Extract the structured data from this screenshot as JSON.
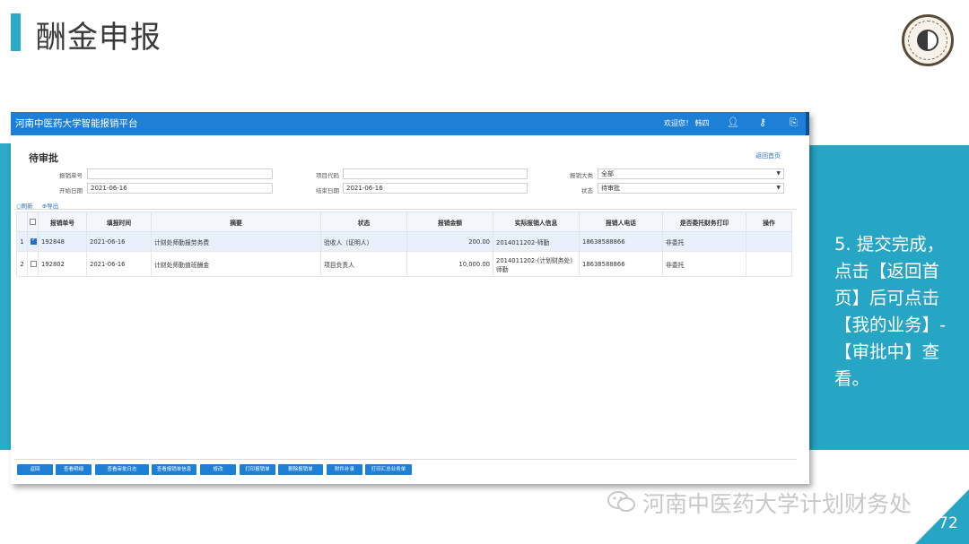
{
  "slide": {
    "title": "酬金申报",
    "note": "5. 提交完成，点击【返回首页】后可点击【我的业务】-【审批中】查看。",
    "watermark": "河南中医药大学计划财务处",
    "page_number": "72",
    "accent_color": "#26a5c4"
  },
  "app": {
    "title": "河南中医药大学智能报销平台",
    "welcome": "欢迎您！ 韩四",
    "header_color": "#1e7fd6",
    "header_icons": [
      "user-icon",
      "key-icon",
      "logout-icon"
    ]
  },
  "page": {
    "title": "待审批",
    "back_link": "返回首页"
  },
  "filters": {
    "report_no": {
      "label": "报销单号",
      "value": ""
    },
    "project_code": {
      "label": "项目代码",
      "value": ""
    },
    "category": {
      "label": "报销大类",
      "value": "全部"
    },
    "start_date": {
      "label": "开始日期",
      "value": "2021-06-16"
    },
    "end_date": {
      "label": "结束日期",
      "value": "2021-06-16"
    },
    "status": {
      "label": "状态",
      "value": "待审批"
    }
  },
  "toolbar": {
    "refresh": "刷新",
    "export": "导出"
  },
  "table": {
    "columns": [
      "报销单号",
      "填报时间",
      "摘要",
      "状态",
      "报销金额",
      "实际报销人信息",
      "报销人电话",
      "是否委托财务打印",
      "操作"
    ],
    "rows": [
      {
        "index": "1",
        "checked": true,
        "report_no": "192848",
        "date": "2021-06-16",
        "summary": "计财处师勤报劳务费",
        "status": "验收人（证明人）",
        "amount": "200.00",
        "claimant": "2014011202-师勤",
        "phone": "18638588866",
        "print": "非委托",
        "action": ""
      },
      {
        "index": "2",
        "checked": false,
        "report_no": "192802",
        "date": "2021-06-16",
        "summary": "计财处师勤值班酬金",
        "status": "项目负责人",
        "amount": "10,000.00",
        "claimant": "2014011202-(计划财务处)师勤",
        "phone": "18638588866",
        "print": "非委托",
        "action": ""
      }
    ]
  },
  "buttons": [
    "返回",
    "查看明细",
    "查看审批日志",
    "查看报销单信息",
    "修改",
    "打印报销单",
    "删除报销单",
    "附件补录",
    "打印汇总业务单"
  ]
}
